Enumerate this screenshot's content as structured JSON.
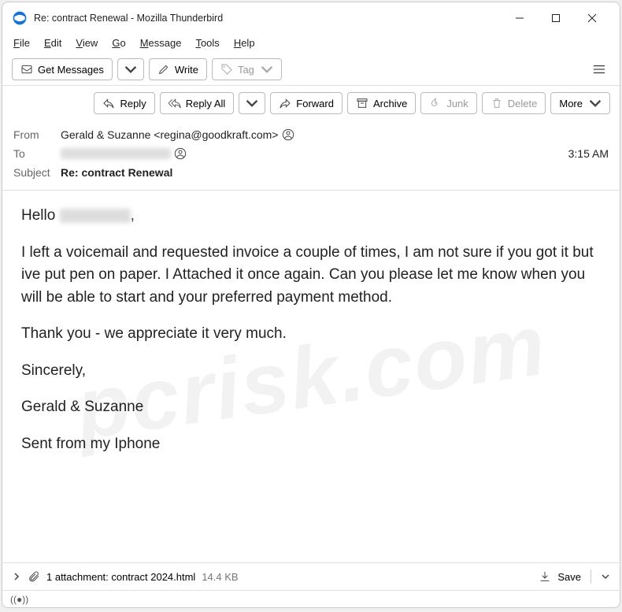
{
  "window": {
    "title": "Re: contract Renewal - Mozilla Thunderbird"
  },
  "menubar": {
    "file": "File",
    "edit": "Edit",
    "view": "View",
    "go": "Go",
    "message": "Message",
    "tools": "Tools",
    "help": "Help"
  },
  "toolbar": {
    "get_messages": "Get Messages",
    "write": "Write",
    "tag": "Tag"
  },
  "msgtoolbar": {
    "reply": "Reply",
    "reply_all": "Reply All",
    "forward": "Forward",
    "archive": "Archive",
    "junk": "Junk",
    "delete": "Delete",
    "more": "More"
  },
  "headers": {
    "from_label": "From",
    "from_value": "Gerald & Suzanne <regina@goodkraft.com>",
    "to_label": "To",
    "subject_label": "Subject",
    "subject_value": "Re: contract Renewal",
    "time": "3:15 AM"
  },
  "body": {
    "greeting_prefix": "Hello ",
    "greeting_suffix": ",",
    "p1": "I left a voicemail and requested invoice a couple of times, I am not sure if you got it but ive put pen on paper. I Attached it once again. Can you please let me know when you will be able to start and your preferred payment method.",
    "p2": "Thank you - we appreciate it very much.",
    "p3": "Sincerely,",
    "p4": "Gerald & Suzanne",
    "p5": "Sent from my Iphone"
  },
  "attachment": {
    "summary": "1 attachment: contract 2024.html",
    "size": "14.4 KB",
    "save": "Save"
  },
  "watermark": "pcrisk.com"
}
